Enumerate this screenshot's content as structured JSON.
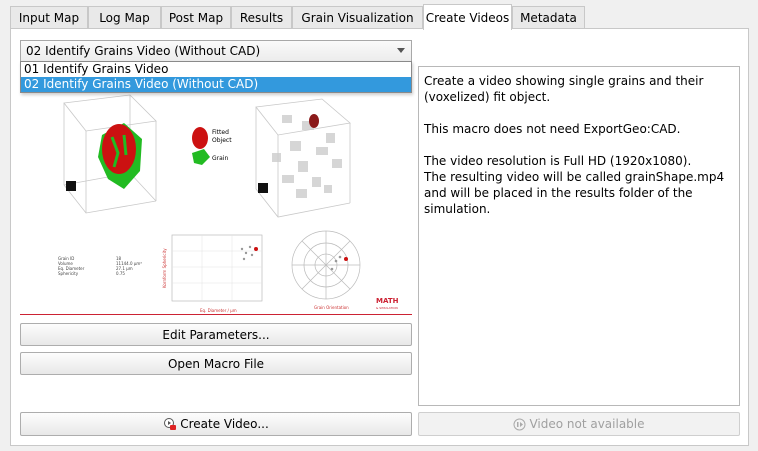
{
  "tabs": [
    {
      "label": "Input Map",
      "active": false
    },
    {
      "label": "Log Map",
      "active": false
    },
    {
      "label": "Post Map",
      "active": false
    },
    {
      "label": "Results",
      "active": false
    },
    {
      "label": "Grain Visualization",
      "active": false
    },
    {
      "label": "Create Videos",
      "active": true
    },
    {
      "label": "Metadata",
      "active": false
    }
  ],
  "macro_select": {
    "value": "02 Identify Grains Video (Without CAD)",
    "options": [
      "01 Identify Grains Video",
      "02 Identify Grains Video (Without CAD)"
    ],
    "selected_index": 1
  },
  "preview": {
    "legend_fitted": "Fitted",
    "legend_object": "Object",
    "legend_grain": "Grain",
    "stats_labels": [
      "Grain ID",
      "Volume",
      "Eq. Diameter",
      "Sphericity"
    ],
    "stats_values": [
      "18",
      "11144.0 µm³",
      "27.1 µm",
      "0.75"
    ],
    "plot_ylabel": "Kornform Sphericity",
    "plot_xlabel": "Eq. Diameter / µm",
    "polar_label": "Grain Orientation",
    "logo": "MATH",
    "logo_sub": "& SIMULATION"
  },
  "buttons": {
    "edit_parameters": "Edit Parameters...",
    "open_macro": "Open Macro File",
    "create_video": "Create Video...",
    "video_not_available": "Video not available"
  },
  "description": {
    "p1": "Create a video showing single grains and their (voxelized) fit object.",
    "p2": "This macro does not need ExportGeo:CAD.",
    "p3a": "The video resolution is Full HD (1920x1080).",
    "p3b": "The resulting video will be called grainShape.mp4 and will be placed in the results folder of the simulation."
  },
  "colors": {
    "accent": "#3399dd",
    "fitted": "#cc1111",
    "grain": "#22bb22",
    "brand": "#cc2233"
  }
}
